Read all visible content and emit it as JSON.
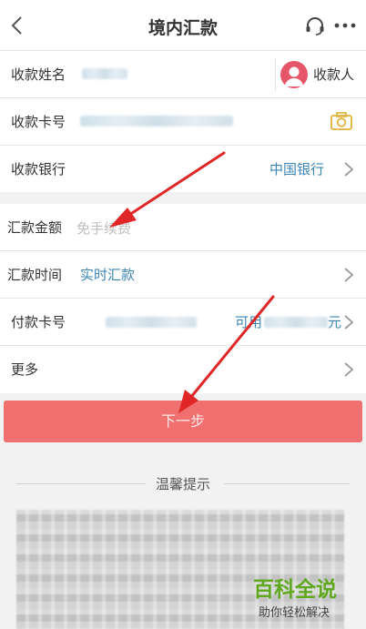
{
  "header": {
    "title": "境内汇款"
  },
  "payee_section": {
    "name_label": "收款姓名",
    "payee_button_label": "收款人",
    "card_label": "收款卡号",
    "bank_label": "收款银行",
    "bank_value": "中国银行"
  },
  "transfer_section": {
    "amount_label": "汇款金额",
    "amount_placeholder": "免手续费",
    "time_label": "汇款时间",
    "time_value": "实时汇款",
    "pay_card_label": "付款卡号",
    "available_label": "可用",
    "available_suffix": "元",
    "more_label": "更多"
  },
  "next_button": {
    "label": "下一步"
  },
  "tips": {
    "title": "温馨提示"
  },
  "watermark": {
    "title": "百科全说",
    "subtitle": "助你轻松解决"
  },
  "icons": [
    "back-icon",
    "headset-icon",
    "more-icon",
    "avatar-icon",
    "camera-icon",
    "chevron-right-icon"
  ],
  "colors": {
    "accent": "#3b86b4",
    "button": "#f07070",
    "annotation_arrow": "#e02626",
    "watermark": "#5fa81f"
  }
}
